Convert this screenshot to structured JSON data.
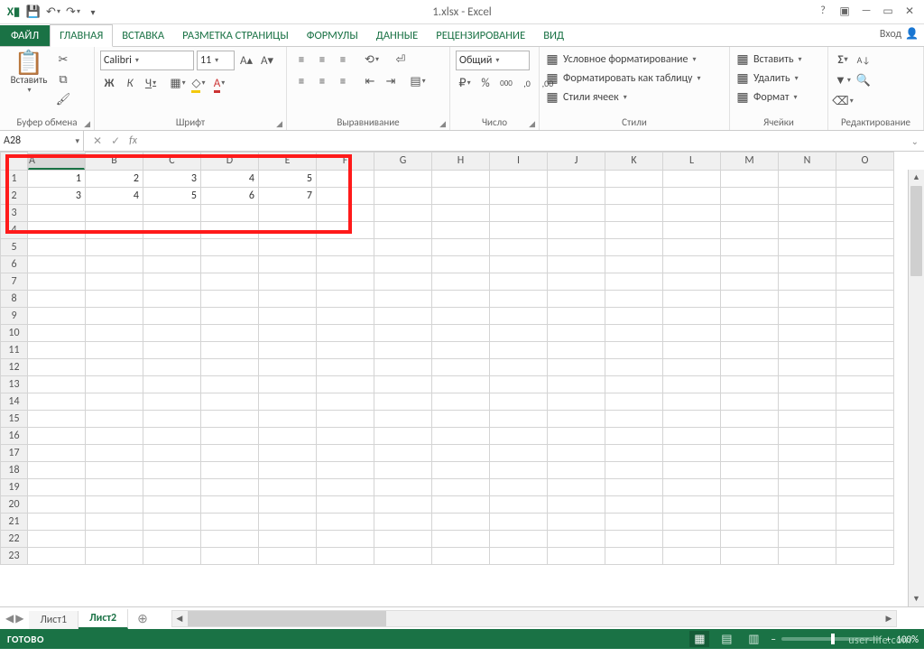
{
  "title": "1.xlsx - Excel",
  "tabs": {
    "file": "ФАЙЛ",
    "home": "ГЛАВНАЯ",
    "insert": "ВСТАВКА",
    "layout": "РАЗМЕТКА СТРАНИЦЫ",
    "formulas": "ФОРМУЛЫ",
    "data": "ДАННЫЕ",
    "review": "РЕЦЕНЗИРОВАНИЕ",
    "view": "ВИД",
    "login": "Вход"
  },
  "ribbon": {
    "clipboard": {
      "paste": "Вставить",
      "label": "Буфер обмена"
    },
    "font": {
      "name": "Calibri",
      "size": "11",
      "label": "Шрифт",
      "bold": "Ж",
      "italic": "К",
      "underline": "Ч"
    },
    "align": {
      "label": "Выравнивание"
    },
    "number": {
      "format": "Общий",
      "label": "Число"
    },
    "styles": {
      "cond": "Условное форматирование",
      "table": "Форматировать как таблицу",
      "cell": "Стили ячеек",
      "label": "Стили"
    },
    "cells": {
      "insert": "Вставить",
      "delete": "Удалить",
      "format": "Формат",
      "label": "Ячейки"
    },
    "edit": {
      "label": "Редактирование"
    }
  },
  "namebox": "A28",
  "fx": "fx",
  "columns": [
    "A",
    "B",
    "C",
    "D",
    "E",
    "F",
    "G",
    "H",
    "I",
    "J",
    "K",
    "L",
    "M",
    "N",
    "O"
  ],
  "rows": [
    "1",
    "2",
    "3",
    "4",
    "5",
    "6",
    "7",
    "8",
    "9",
    "10",
    "11",
    "12",
    "13",
    "14",
    "15",
    "16",
    "17",
    "18",
    "19",
    "20",
    "21",
    "22",
    "23"
  ],
  "cells": {
    "r1": {
      "A": "1",
      "B": "2",
      "C": "3",
      "D": "4",
      "E": "5"
    },
    "r2": {
      "A": "3",
      "B": "4",
      "C": "5",
      "D": "6",
      "E": "7"
    }
  },
  "sheets": {
    "s1": "Лист1",
    "s2": "Лист2"
  },
  "status": {
    "ready": "ГОТОВО",
    "zoom": "100%"
  },
  "watermark": "user-life.com"
}
